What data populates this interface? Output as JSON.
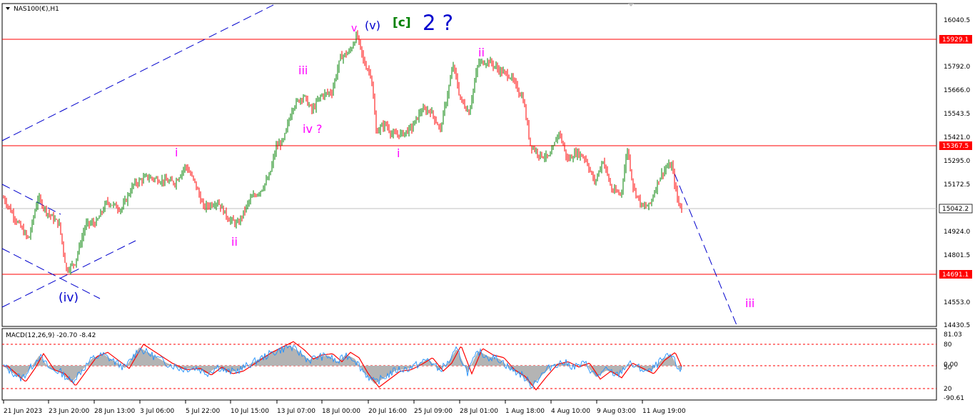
{
  "header": {
    "symbol": "NAS100(€),H1"
  },
  "indicator": {
    "label": "MACD(12,26,9) -20.70 -8.42",
    "y_ticks": [
      "81.03",
      "80",
      "0.00",
      "50",
      "20",
      "-90.61"
    ]
  },
  "colors": {
    "up_candle": "#008000",
    "down_candle": "#ff0000",
    "macd_hist": "#b4b4b4",
    "macd_signal": "#ff0000",
    "macd_line": "#1e90ff",
    "wave_minor": "#ff00ff",
    "wave_intermediate": "#0000cd",
    "wave_primary": "#008000",
    "hline": "#ff0000"
  },
  "chart_data": {
    "type": "candlestick",
    "y_ticks": [
      "16040.5",
      "15792.0",
      "15666.0",
      "15543.5",
      "15421.0",
      "15295.0",
      "15172.5",
      "14924.0",
      "14801.5",
      "14553.0",
      "14430.5"
    ],
    "x_ticks": [
      "21 Jun 2023",
      "23 Jun 20:00",
      "28 Jun 13:00",
      "3 Jul 06:00",
      "5 Jul 22:00",
      "10 Jul 15:00",
      "13 Jul 07:00",
      "18 Jul 00:00",
      "20 Jul 16:00",
      "25 Jul 09:00",
      "28 Jul 01:00",
      "1 Aug 18:00",
      "4 Aug 10:00",
      "9 Aug 03:00",
      "11 Aug 19:00"
    ],
    "price_path": [
      [
        0,
        15100
      ],
      [
        18,
        14980
      ],
      [
        35,
        14880
      ],
      [
        48,
        15100
      ],
      [
        62,
        15020
      ],
      [
        78,
        14960
      ],
      [
        88,
        14720
      ],
      [
        100,
        14760
      ],
      [
        115,
        14960
      ],
      [
        130,
        14970
      ],
      [
        145,
        15080
      ],
      [
        165,
        15040
      ],
      [
        182,
        15170
      ],
      [
        200,
        15210
      ],
      [
        218,
        15195
      ],
      [
        240,
        15180
      ],
      [
        255,
        15270
      ],
      [
        268,
        15180
      ],
      [
        280,
        15050
      ],
      [
        300,
        15080
      ],
      [
        315,
        14990
      ],
      [
        328,
        14960
      ],
      [
        345,
        15090
      ],
      [
        360,
        15140
      ],
      [
        372,
        15210
      ],
      [
        382,
        15370
      ],
      [
        392,
        15400
      ],
      [
        405,
        15580
      ],
      [
        420,
        15640
      ],
      [
        432,
        15560
      ],
      [
        445,
        15640
      ],
      [
        460,
        15660
      ],
      [
        472,
        15840
      ],
      [
        485,
        15870
      ],
      [
        495,
        15960
      ],
      [
        505,
        15810
      ],
      [
        515,
        15750
      ],
      [
        522,
        15450
      ],
      [
        535,
        15490
      ],
      [
        545,
        15430
      ],
      [
        560,
        15440
      ],
      [
        572,
        15470
      ],
      [
        585,
        15560
      ],
      [
        598,
        15560
      ],
      [
        612,
        15460
      ],
      [
        630,
        15800
      ],
      [
        640,
        15620
      ],
      [
        652,
        15550
      ],
      [
        665,
        15810
      ],
      [
        680,
        15820
      ],
      [
        695,
        15770
      ],
      [
        710,
        15740
      ],
      [
        728,
        15620
      ],
      [
        738,
        15380
      ],
      [
        750,
        15330
      ],
      [
        765,
        15310
      ],
      [
        778,
        15450
      ],
      [
        790,
        15300
      ],
      [
        803,
        15340
      ],
      [
        815,
        15310
      ],
      [
        828,
        15180
      ],
      [
        840,
        15300
      ],
      [
        852,
        15140
      ],
      [
        865,
        15120
      ],
      [
        874,
        15360
      ],
      [
        882,
        15160
      ],
      [
        895,
        15050
      ],
      [
        905,
        15060
      ],
      [
        918,
        15200
      ],
      [
        928,
        15260
      ],
      [
        936,
        15270
      ],
      [
        944,
        15090
      ],
      [
        950,
        15040
      ]
    ],
    "price_ticks": {
      "horizontal_lines": [
        15929.1,
        15367.5,
        14691.1
      ],
      "last_price": 15042.2,
      "labels": [
        "15929.1",
        "15367.5",
        "15042.2",
        "14691.1"
      ]
    },
    "macd_path": [
      [
        0,
        -2
      ],
      [
        12,
        -30
      ],
      [
        25,
        -60
      ],
      [
        38,
        -10
      ],
      [
        50,
        45
      ],
      [
        65,
        -15
      ],
      [
        80,
        -30
      ],
      [
        95,
        -75
      ],
      [
        110,
        -20
      ],
      [
        125,
        35
      ],
      [
        140,
        50
      ],
      [
        155,
        20
      ],
      [
        170,
        -10
      ],
      [
        190,
        80
      ],
      [
        210,
        45
      ],
      [
        230,
        10
      ],
      [
        250,
        -15
      ],
      [
        270,
        -10
      ],
      [
        285,
        -35
      ],
      [
        300,
        -5
      ],
      [
        315,
        -30
      ],
      [
        330,
        -20
      ],
      [
        350,
        15
      ],
      [
        370,
        50
      ],
      [
        385,
        70
      ],
      [
        400,
        90
      ],
      [
        415,
        60
      ],
      [
        428,
        25
      ],
      [
        440,
        40
      ],
      [
        455,
        45
      ],
      [
        468,
        15
      ],
      [
        480,
        50
      ],
      [
        492,
        30
      ],
      [
        505,
        -30
      ],
      [
        520,
        -80
      ],
      [
        535,
        -50
      ],
      [
        550,
        -20
      ],
      [
        565,
        -15
      ],
      [
        580,
        5
      ],
      [
        595,
        30
      ],
      [
        610,
        -20
      ],
      [
        622,
        10
      ],
      [
        635,
        75
      ],
      [
        650,
        -30
      ],
      [
        665,
        65
      ],
      [
        680,
        40
      ],
      [
        695,
        30
      ],
      [
        710,
        -15
      ],
      [
        725,
        -40
      ],
      [
        740,
        -90
      ],
      [
        755,
        -40
      ],
      [
        770,
        5
      ],
      [
        785,
        15
      ],
      [
        800,
        -5
      ],
      [
        815,
        10
      ],
      [
        830,
        -50
      ],
      [
        845,
        -20
      ],
      [
        860,
        -45
      ],
      [
        875,
        10
      ],
      [
        890,
        -10
      ],
      [
        905,
        -30
      ],
      [
        920,
        20
      ],
      [
        935,
        50
      ],
      [
        945,
        -10
      ],
      [
        950,
        -20
      ]
    ],
    "labels": [
      "v",
      "(v)",
      "[c]",
      "2 ?",
      "iii",
      "iv ?",
      "i",
      "ii",
      "ii",
      "i",
      "(iv)",
      "iii"
    ]
  }
}
